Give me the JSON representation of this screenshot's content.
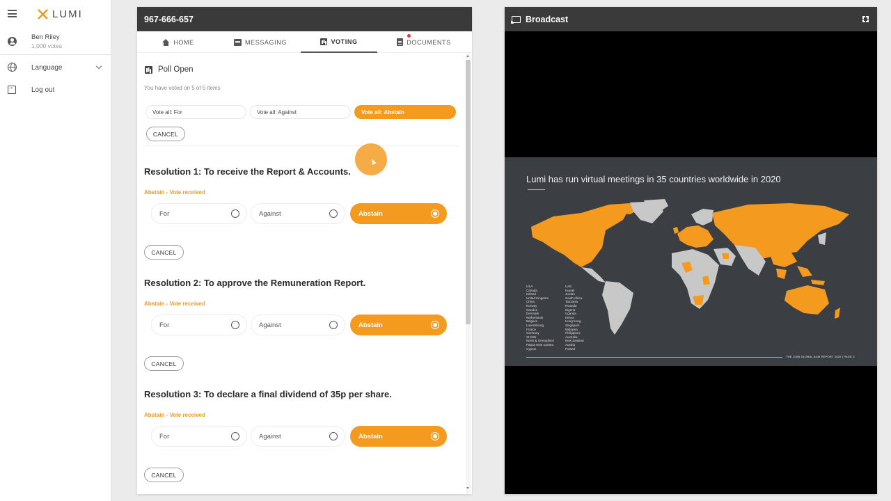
{
  "app": {
    "brand": "LUMI",
    "accent_color": "#f39a1f"
  },
  "sidebar": {
    "user": {
      "name": "Ben Riley",
      "votes": "1,000 votes"
    },
    "items": [
      {
        "label": "Language",
        "icon": "globe-icon"
      },
      {
        "label": "Log out",
        "icon": "logout-icon"
      }
    ]
  },
  "meeting": {
    "id": "967-666-657"
  },
  "tabs": [
    {
      "label": "HOME",
      "icon": "home-icon"
    },
    {
      "label": "MESSAGING",
      "icon": "message-icon"
    },
    {
      "label": "VOTING",
      "icon": "voting-icon",
      "active": true
    },
    {
      "label": "DOCUMENTS",
      "icon": "document-icon"
    }
  ],
  "poll": {
    "title": "Poll Open",
    "voted_text": "You have voted on 5 of 5 items",
    "vote_all": [
      "Vote all: For",
      "Vote all: Against",
      "Vote all: Abstain"
    ],
    "vote_all_selected": "Vote all: Abstain",
    "cancel_label": "CANCEL"
  },
  "resolutions": [
    {
      "title": "Resolution 1: To receive the Report & Accounts.",
      "status": "Abstain - Vote received",
      "options": [
        "For",
        "Against",
        "Abstain"
      ],
      "selected": "Abstain",
      "cancel_label": "CANCEL"
    },
    {
      "title": "Resolution 2: To approve the Remuneration Report.",
      "status": "Abstain - Vote received",
      "options": [
        "For",
        "Against",
        "Abstain"
      ],
      "selected": "Abstain",
      "cancel_label": "CANCEL"
    },
    {
      "title": "Resolution 3: To declare a final dividend of 35p per share.",
      "status": "Abstain - Vote received",
      "options": [
        "For",
        "Against",
        "Abstain"
      ],
      "selected": "Abstain",
      "cancel_label": "CANCEL"
    }
  ],
  "broadcast": {
    "title": "Broadcast",
    "slide": {
      "title": "Lumi has run virtual meetings in 35 countries worldwide in 2020",
      "countries_col1": [
        "USA",
        "Canada",
        "Ireland",
        "United Kingdom",
        "China",
        "Norway",
        "Sweden",
        "Denmark",
        "Netherlands",
        "Belgium",
        "Luxembourg",
        "France",
        "Germany",
        "St Kitts",
        "Nevis & Grenadines",
        "Papua New Guinea",
        "Cyprus"
      ],
      "countries_col2": [
        "UAE",
        "Kuwait",
        "Jordan",
        "South Africa",
        "Tanzania",
        "Rwanda",
        "Nigeria",
        "Uganda",
        "Kenya",
        "Hong Kong",
        "Singapore",
        "Malaysia",
        "Philippines",
        "Australia",
        "New Zealand",
        "Austria",
        "Poland"
      ],
      "footer": "THE LUMI GLOBAL AGM REPORT 2020 | PAGE 3"
    }
  }
}
